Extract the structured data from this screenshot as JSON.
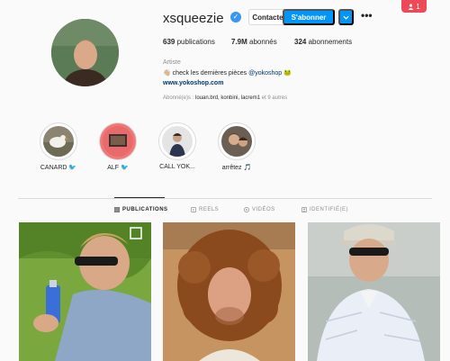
{
  "notification": {
    "count": "1"
  },
  "profile": {
    "username": "xsqueezie",
    "contact_label": "Contacter",
    "follow_label": "S'abonner",
    "stats": {
      "posts": "639",
      "posts_label": "publications",
      "followers": "7.9M",
      "followers_label": "abonnés",
      "following": "324",
      "following_label": "abonnements"
    },
    "category": "Artiste",
    "bio_text": "check les dernières pièces",
    "bio_mention": "@yokoshop",
    "website": "www.yokoshop.com",
    "followed_by_prefix": "Abonné(e)s :",
    "followed_by_names": "louan.brd, konbini, lacrem1",
    "followed_by_suffix": "et 9 autres"
  },
  "highlights": [
    {
      "label": "CANARD 🐦"
    },
    {
      "label": "ALF 🐦"
    },
    {
      "label": "CALL YOK..."
    },
    {
      "label": "arrêtez 🎵"
    }
  ],
  "tabs": [
    {
      "label": "PUBLICATIONS",
      "icon": "grid-icon"
    },
    {
      "label": "REELS",
      "icon": "reels-icon"
    },
    {
      "label": "VIDÉOS",
      "icon": "video-icon"
    },
    {
      "label": "IDENTIFIÉ(E)",
      "icon": "tag-icon"
    }
  ]
}
